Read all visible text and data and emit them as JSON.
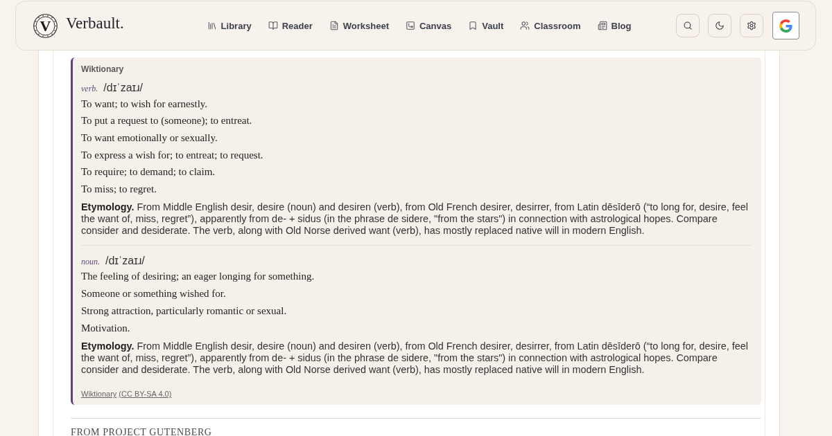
{
  "header": {
    "logo_mark": "V",
    "brand": "Verbault.",
    "nav": [
      {
        "label": "Library"
      },
      {
        "label": "Reader"
      },
      {
        "label": "Worksheet"
      },
      {
        "label": "Canvas"
      },
      {
        "label": "Vault"
      },
      {
        "label": "Classroom"
      },
      {
        "label": "Blog"
      }
    ]
  },
  "wiktionary": {
    "source_label": "Wiktionary",
    "entries": [
      {
        "part_of_speech": "verb.",
        "pronunciation": "/dɪˈzaɪɹ/",
        "definitions": [
          "To want; to wish for earnestly.",
          "To put a request to (someone); to entreat.",
          "To want emotionally or sexually.",
          "To express a wish for; to entreat; to request.",
          "To require; to demand; to claim.",
          "To miss; to regret."
        ],
        "etymology": "**Etymology.** From Middle English desir, desire (noun) and desiren (verb), from Old French desirer, desirrer, from Latin dēsīderō (“to long for, desire, feel the want of, miss, regret”), apparently from de- + sidus (in the phrase de sidere, \"from the stars\") in connection with astrological hopes. Compare consider and desiderate. The verb, along with Old Norse derived want (verb), has mostly replaced native will in modern English."
      },
      {
        "part_of_speech": "noun.",
        "pronunciation": "/dɪˈzaɪɹ/",
        "definitions": [
          "The feeling of desiring; an eager longing for something.",
          "Someone or something wished for.",
          "Strong attraction, particularly romantic or sexual.",
          "Motivation."
        ],
        "etymology": "**Etymology.** From Middle English desir, desire (noun) and desiren (verb), from Old French desirer, desirrer, from Latin dēsīderō (“to long for, desire, feel the want of, miss, regret”), apparently from de- + sidus (in the phrase de sidere, \"from the stars\") in connection with astrological hopes. Compare consider and desiderate. The verb, along with Old Norse derived want (verb), has mostly replaced native will in modern English."
      }
    ],
    "attribution": {
      "source_link": "Wiktionary",
      "license_link": "(CC BY-SA 4.0)"
    }
  },
  "next_section": {
    "heading": "FROM PROJECT GUTENBERG"
  }
}
